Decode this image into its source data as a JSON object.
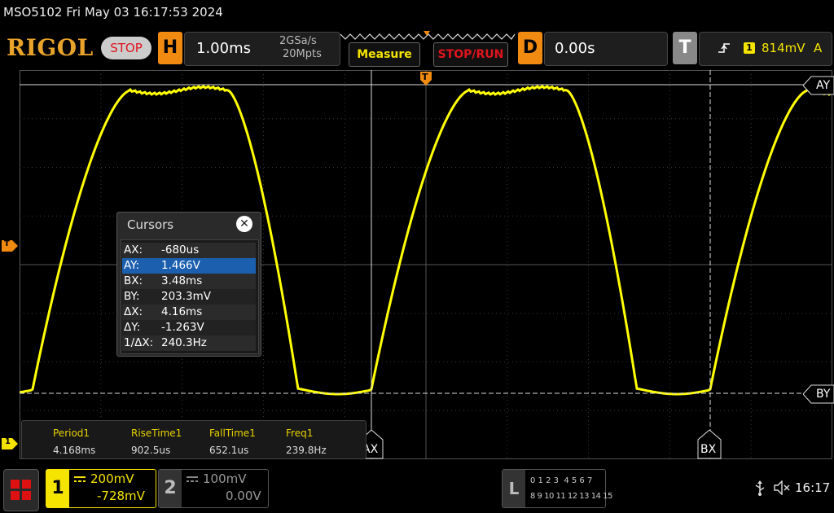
{
  "title_bar": {
    "text": "MSO5102  Fri May 03 16:17:53 2024"
  },
  "brand": {
    "logo": "RIGOL",
    "run_state": "STOP"
  },
  "horizontal": {
    "letter": "H",
    "timebase": "1.00ms",
    "sample_rate": "2GSa/s",
    "memory_depth": "20Mpts"
  },
  "buttons": {
    "measure": "Measure",
    "stop_run": "STOP/RUN"
  },
  "delay": {
    "letter": "D",
    "value": "0.00s"
  },
  "trigger": {
    "letter": "T",
    "source_num": "1",
    "level": "814mV",
    "mode": "A",
    "marker": "T"
  },
  "cursor_labels": {
    "ay": "AY",
    "by": "BY",
    "ax": "AX",
    "bx": "BX"
  },
  "ch1_marker": "1",
  "cursors_panel": {
    "title": "Cursors",
    "close_glyph": "✕",
    "rows": [
      {
        "k": "AX:",
        "v": "-680us"
      },
      {
        "k": "AY:",
        "v": "1.466V"
      },
      {
        "k": "BX:",
        "v": "3.48ms"
      },
      {
        "k": "BY:",
        "v": "203.3mV"
      },
      {
        "k": "ΔX:",
        "v": "4.16ms"
      },
      {
        "k": "ΔY:",
        "v": "-1.263V"
      },
      {
        "k": "1/ΔX:",
        "v": "240.3Hz"
      }
    ]
  },
  "measurements": {
    "items": [
      {
        "name": "Period1",
        "value": "4.168ms"
      },
      {
        "name": "RiseTime1",
        "value": "902.5us"
      },
      {
        "name": "FallTime1",
        "value": "652.1us"
      },
      {
        "name": "Freq1",
        "value": "239.8Hz"
      }
    ]
  },
  "channels": {
    "ch1": {
      "num": "1",
      "scale": "200mV",
      "offset": "-728mV"
    },
    "ch2": {
      "num": "2",
      "scale": "100mV",
      "offset": "0.00V"
    }
  },
  "logic": {
    "letter": "L",
    "row1": "0 1 2 3  4 5 6 7",
    "row2": "8 9 10 11 12 13 14 15"
  },
  "status": {
    "clock": "16:17"
  },
  "colors": {
    "ch1": "#ffff00",
    "accent": "#f08a10",
    "stop": "#e0141d",
    "logo": "#e8a32a"
  }
}
